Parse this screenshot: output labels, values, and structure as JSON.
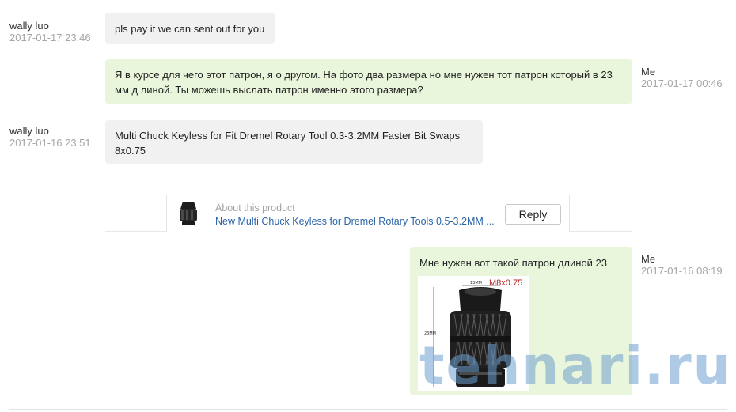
{
  "messages": [
    {
      "sender": "wally luo",
      "time": "2017-01-17 23:46",
      "text": "pls pay it we can sent out for you"
    },
    {
      "sender": "Me",
      "time": "2017-01-17 00:46",
      "text": "Я в курсе для чего этот патрон, я о другом. На фото два размера но мне нужен тот патрон который в 23 мм д линой. Ты можешь выслать патрон именно этого размера?"
    },
    {
      "sender": "wally luo",
      "time": "2017-01-16 23:51",
      "text": "Multi Chuck Keyless for Fit Dremel Rotary Tool 0.3-3.2MM Faster Bit Swaps 8x0.75"
    },
    {
      "sender": "Me",
      "time": "2017-01-16 08:19",
      "text": "Мне нужен вот такой патрон длиной 23 мм:"
    }
  ],
  "product": {
    "caption": "About this product",
    "link_text": "New Multi Chuck Keyless for Dremel Rotary Tools 0.5-3.2MM ...",
    "reply_label": "Reply"
  },
  "photo": {
    "thread_label": "M8x0.75",
    "width_label": "13MM",
    "height_label": "23MM"
  },
  "watermark": "tehnari.ru",
  "colors": {
    "incoming_bubble": "#f1f1f1",
    "outgoing_bubble": "#eaf6dc",
    "link": "#2a64a8",
    "timestamp": "#a6a6a6"
  }
}
